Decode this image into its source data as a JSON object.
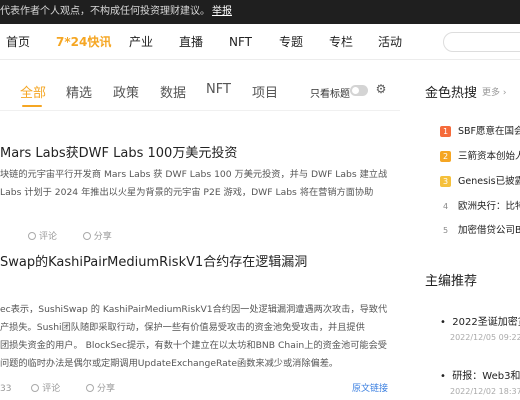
{
  "topbar": {
    "notice": "代表作者个人观点，不构成任何投资理财建议。",
    "report": "举报"
  },
  "nav": {
    "items": [
      "首页",
      "7*24快讯",
      "产业",
      "直播",
      "NFT",
      "专题",
      "专栏",
      "活动"
    ],
    "active": "7*24快讯"
  },
  "tabs": {
    "items": [
      "全部",
      "精选",
      "政策",
      "数据",
      "NFT",
      "项目"
    ],
    "active": "全部",
    "toggle_label": "只看标题"
  },
  "articles": [
    {
      "title": "Mars Labs获DWF Labs 100万美元投资",
      "lines": [
        "块链的元宇宙平行开发商 Mars Labs 获 DWF Labs 100 万美元投资，并与 DWF Labs 建立战",
        "Labs 计划于 2024 年推出以火星为背景的元宇宙 P2E 游戏，DWF Labs 将在营销方面协助"
      ],
      "comment": "评论",
      "share": "分享"
    },
    {
      "title": "Swap的KashiPairMediumRiskV1合约存在逻辑漏洞",
      "lines": [
        "ec表示，SushiSwap 的 KashiPairMediumRiskV1合约因一处逻辑漏洞遭遇两次攻击，导致代",
        "产损失。Sushi团队随即采取行动，保护一些有价值易受攻击的资金池免受攻击，并且提供",
        "团损失资金的用户。 BlockSec提示，有数十个建立在以太坊和BNB Chain上的资金池可能会受",
        "问题的临时办法是偶尔或定期调用UpdateExchangeRate函数来减少或消除偏差。"
      ],
      "count": "33",
      "comment": "评论",
      "share": "分享",
      "source": "原文链接"
    }
  ],
  "sidebar": {
    "hot_title": "金色热搜",
    "more": "更多 ›",
    "hot_items": [
      {
        "rank": "1",
        "text": "SBF愿意在国会"
      },
      {
        "rank": "2",
        "text": "三箭资本创始人"
      },
      {
        "rank": "3",
        "text": "Genesis已披露"
      },
      {
        "rank": "4",
        "text": "欧洲央行：比特"
      },
      {
        "rank": "5",
        "text": "加密借贷公司B"
      }
    ],
    "rec_title": "主编推荐",
    "rec_items": [
      {
        "text": "2022圣诞加密货币",
        "date": "2022/12/05 09:22"
      },
      {
        "text": "研报：Web3和数",
        "date": "2022/12/02 18:37"
      }
    ]
  },
  "colors": {
    "accent": "#f5a623",
    "link": "#3b7fe0",
    "topbar_bg": "#1f1f1f"
  }
}
